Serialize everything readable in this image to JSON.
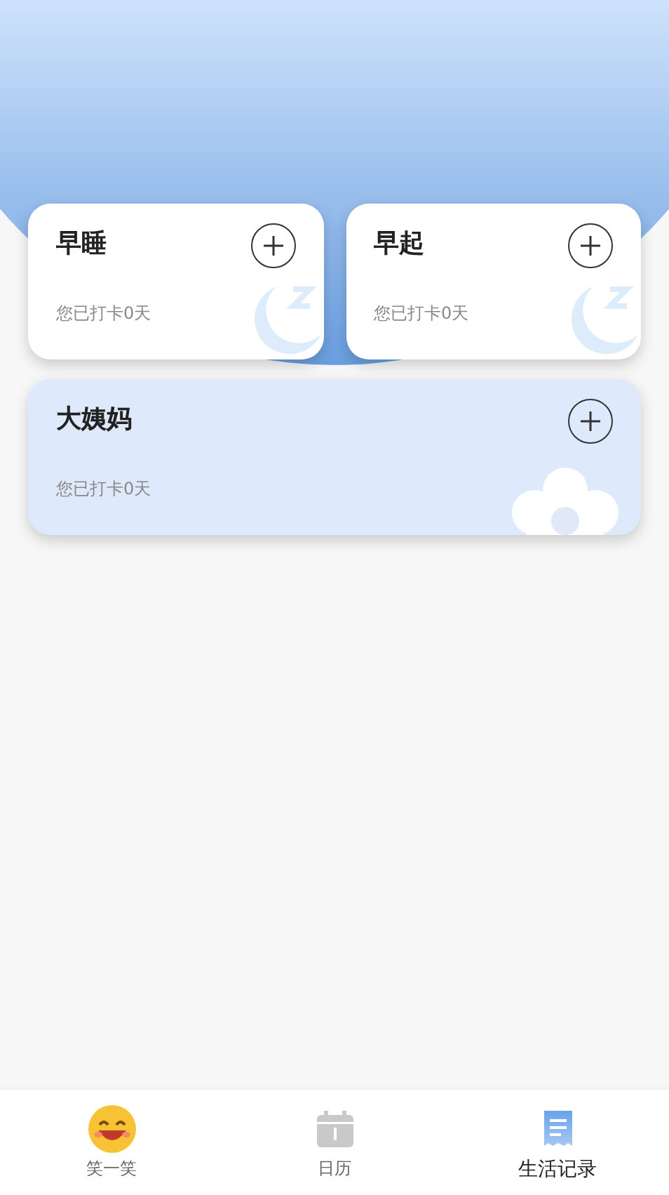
{
  "cards": [
    {
      "title": "早睡",
      "subtitle": "您已打卡0天",
      "kind": "sleep",
      "wide": false
    },
    {
      "title": "早起",
      "subtitle": "您已打卡0天",
      "kind": "sleep",
      "wide": false
    },
    {
      "title": "大姨妈",
      "subtitle": "您已打卡0天",
      "kind": "flower",
      "wide": true
    }
  ],
  "tabs": [
    {
      "label": "笑一笑",
      "kind": "smile",
      "selected": false
    },
    {
      "label": "日历",
      "kind": "calendar",
      "selected": false
    },
    {
      "label": "生活记录",
      "kind": "record",
      "selected": true
    }
  ]
}
